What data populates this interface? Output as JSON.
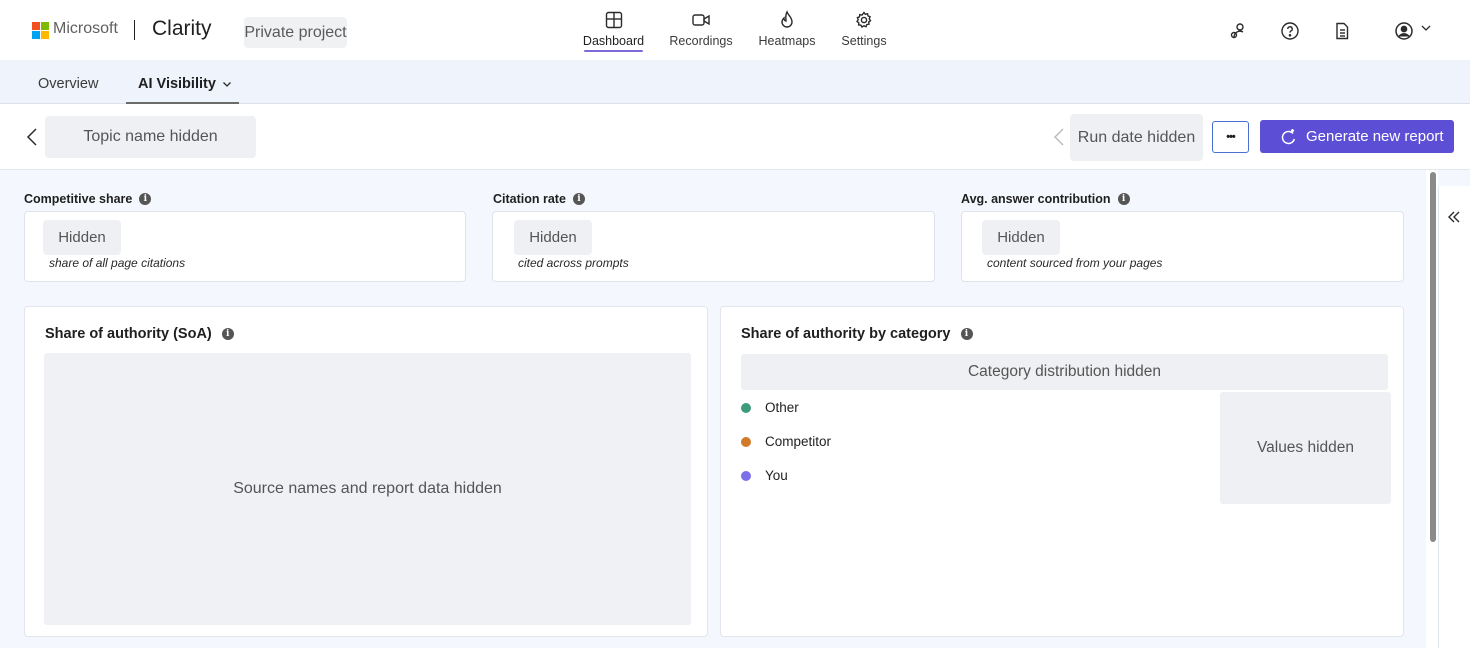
{
  "header": {
    "brand": "Microsoft",
    "product": "Clarity",
    "project": "Private project",
    "nav": [
      {
        "label": "Dashboard",
        "icon": "dashboard-icon",
        "active": true
      },
      {
        "label": "Recordings",
        "icon": "video-icon",
        "active": false
      },
      {
        "label": "Heatmaps",
        "icon": "flame-icon",
        "active": false
      },
      {
        "label": "Settings",
        "icon": "gear-icon",
        "active": false
      }
    ],
    "right_icons": [
      "people-settings-icon",
      "help-icon",
      "document-icon",
      "account-icon"
    ]
  },
  "subnav": {
    "tabs": [
      {
        "label": "Overview"
      },
      {
        "label": "AI Visibility"
      }
    ]
  },
  "topic_bar": {
    "topic": "Topic name hidden",
    "run_date": "Run date hidden",
    "more_label": "•••",
    "generate_label": "Generate new report"
  },
  "metrics": [
    {
      "label": "Competitive share",
      "value": "Hidden",
      "sub": "share of all page citations"
    },
    {
      "label": "Citation rate",
      "value": "Hidden",
      "sub": "cited across prompts"
    },
    {
      "label": "Avg. answer contribution",
      "value": "Hidden",
      "sub": "content sourced from your pages"
    }
  ],
  "soa_panel": {
    "title": "Share of authority (SoA)",
    "placeholder": "Source names and report data hidden"
  },
  "category_panel": {
    "title": "Share of authority by category",
    "placeholder": "Category distribution hidden",
    "legend": [
      {
        "label": "Other",
        "color": "#3f9a7d"
      },
      {
        "label": "Competitor",
        "color": "#d07a2a"
      },
      {
        "label": "You",
        "color": "#7b6ee8"
      }
    ],
    "values_placeholder": "Values hidden"
  },
  "colors": {
    "accent": "#5c4fd6",
    "tab_underline": "#7f6ad8"
  }
}
